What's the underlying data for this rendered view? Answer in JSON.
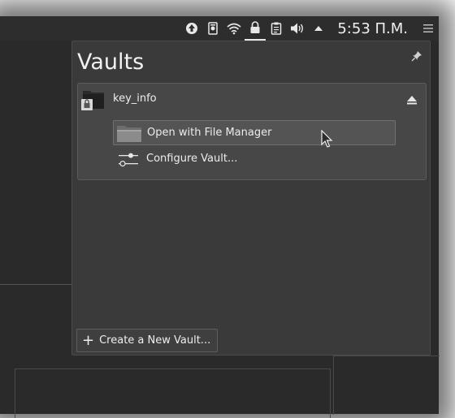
{
  "taskbar": {
    "clock": "5:53 П.М.",
    "tray_icons": [
      "updates-icon",
      "device-icon",
      "wifi-icon",
      "vault-lock-icon",
      "clipboard-icon",
      "volume-icon",
      "expand-tray-icon"
    ],
    "menu_icon": "hamburger-icon"
  },
  "popup": {
    "title": "Vaults",
    "pin_icon": "pin-icon",
    "vault": {
      "name": "key_info",
      "icon": "vault-folder-icon",
      "eject_icon": "eject-icon",
      "actions": [
        {
          "label": "Open with File Manager",
          "icon": "folder-icon"
        },
        {
          "label": "Configure Vault...",
          "icon": "configure-icon"
        }
      ]
    },
    "create_button": {
      "label": "Create a New Vault...",
      "icon": "plus-icon"
    }
  },
  "colors": {
    "panel_bg": "#3a3a3a",
    "item_bg": "#474747",
    "text": "#eeeeee"
  }
}
